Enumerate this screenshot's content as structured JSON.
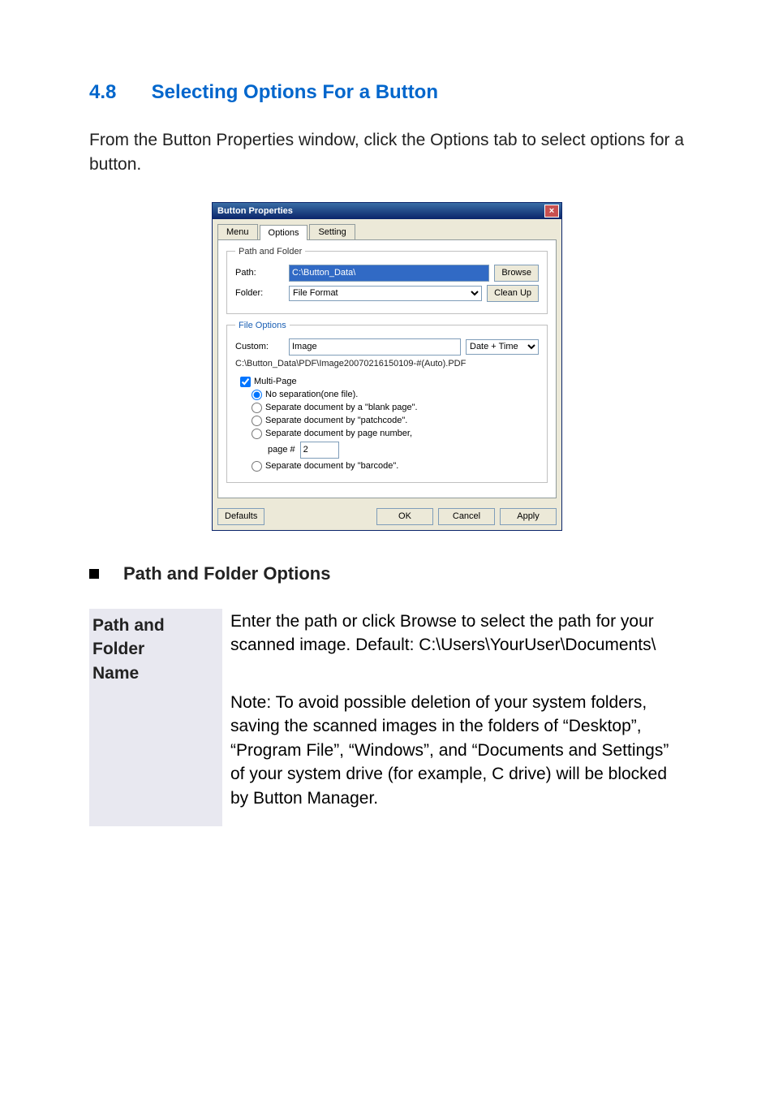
{
  "section": {
    "number": "4.8",
    "title": "Selecting Options For a Button"
  },
  "intro_text": "From the Button Properties window, click the Options tab to select options for a button.",
  "dialog": {
    "title": "Button Properties",
    "tabs": {
      "menu": "Menu",
      "options": "Options",
      "setting": "Setting"
    },
    "path_folder": {
      "legend": "Path and Folder",
      "path_label": "Path:",
      "path_value": "C:\\Button_Data\\",
      "browse": "Browse",
      "folder_label": "Folder:",
      "folder_value": "File Format",
      "cleanup": "Clean Up"
    },
    "file_options": {
      "legend": "File Options",
      "custom_label": "Custom:",
      "custom_value": "Image",
      "datetime": "Date + Time",
      "example_path": "C:\\Button_Data\\PDF\\Image20070216150109-#(Auto).PDF",
      "multipage": "Multi-Page",
      "radios": {
        "no_sep": "No separation(one file).",
        "blank": "Separate document by a \"blank page\".",
        "patch": "Separate document by \"patchcode\".",
        "pagenum": "Separate document by page number,",
        "page_label": "page #",
        "page_value": "2",
        "barcode": "Separate document by \"barcode\"."
      }
    },
    "footer": {
      "defaults": "Defaults",
      "ok": "OK",
      "cancel": "Cancel",
      "apply": "Apply"
    }
  },
  "sub_heading": "Path and Folder Options",
  "definition": {
    "term_line1": "Path and",
    "term_line2": "Folder",
    "term_line3": "Name",
    "para1": "Enter the path or click Browse to select the path for your scanned image. Default: C:\\Users\\YourUser\\Documents\\",
    "para2": "Note: To avoid possible deletion of your system folders, saving the scanned images in the folders of “Desktop”, “Program File”, “Windows”, and “Documents and Settings” of your system drive (for example, C drive) will be blocked by Button Manager."
  }
}
